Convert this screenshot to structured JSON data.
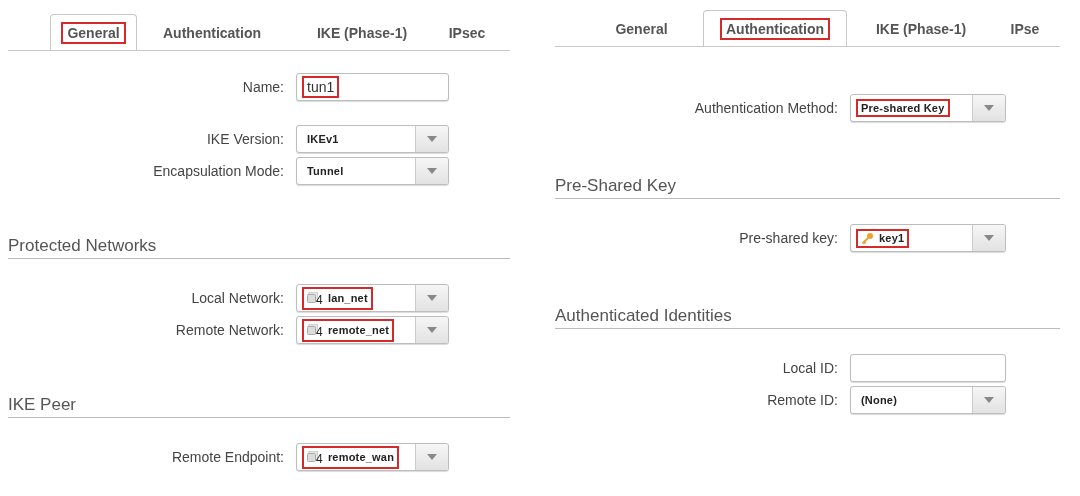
{
  "panels": [
    {
      "tabs": [
        {
          "label": "General",
          "selected": true,
          "highlighted": true
        },
        {
          "label": "Authentication",
          "selected": false,
          "highlighted": false
        },
        {
          "label": "IKE (Phase-1)",
          "selected": false,
          "highlighted": false
        },
        {
          "label": "IPsec",
          "selected": false,
          "highlighted": false
        }
      ],
      "sections": [
        {
          "groups": [
            [
              {
                "label": "Name:",
                "kind": "text",
                "value": "tun1",
                "highlighted": true
              }
            ],
            [
              {
                "label": "IKE Version:",
                "kind": "select",
                "value": "IKEv1",
                "highlighted": false
              },
              {
                "label": "Encapsulation Mode:",
                "kind": "select",
                "value": "Tunnel",
                "highlighted": false
              }
            ]
          ]
        },
        {
          "heading": "Protected Networks",
          "groups": [
            [
              {
                "label": "Local Network:",
                "kind": "network",
                "badge": "4",
                "value": "lan_net",
                "highlighted": true
              },
              {
                "label": "Remote Network:",
                "kind": "network",
                "badge": "4",
                "value": "remote_net",
                "highlighted": true
              }
            ]
          ]
        },
        {
          "heading": "IKE Peer",
          "groups": [
            [
              {
                "label": "Remote Endpoint:",
                "kind": "network",
                "badge": "4",
                "value": "remote_wan",
                "highlighted": true
              }
            ]
          ]
        }
      ]
    },
    {
      "tabs": [
        {
          "label": "General",
          "selected": false,
          "highlighted": false
        },
        {
          "label": "Authentication",
          "selected": true,
          "highlighted": true
        },
        {
          "label": "IKE (Phase-1)",
          "selected": false,
          "highlighted": false
        },
        {
          "label": "IPse",
          "selected": false,
          "highlighted": false
        }
      ],
      "sections": [
        {
          "groups": [
            [
              {
                "label": "Authentication Method:",
                "kind": "select",
                "value": "Pre-shared Key",
                "highlighted": true
              }
            ]
          ]
        },
        {
          "heading": "Pre-Shared Key",
          "groups": [
            [
              {
                "label": "Pre-shared key:",
                "kind": "key",
                "value": "key1",
                "highlighted": true
              }
            ]
          ]
        },
        {
          "heading": "Authenticated Identities",
          "groups": [
            [
              {
                "label": "Local ID:",
                "kind": "text",
                "highlighted": false
              },
              {
                "label": "Remote ID:",
                "kind": "select",
                "value": "(None)",
                "highlighted": false
              }
            ]
          ]
        }
      ]
    }
  ]
}
